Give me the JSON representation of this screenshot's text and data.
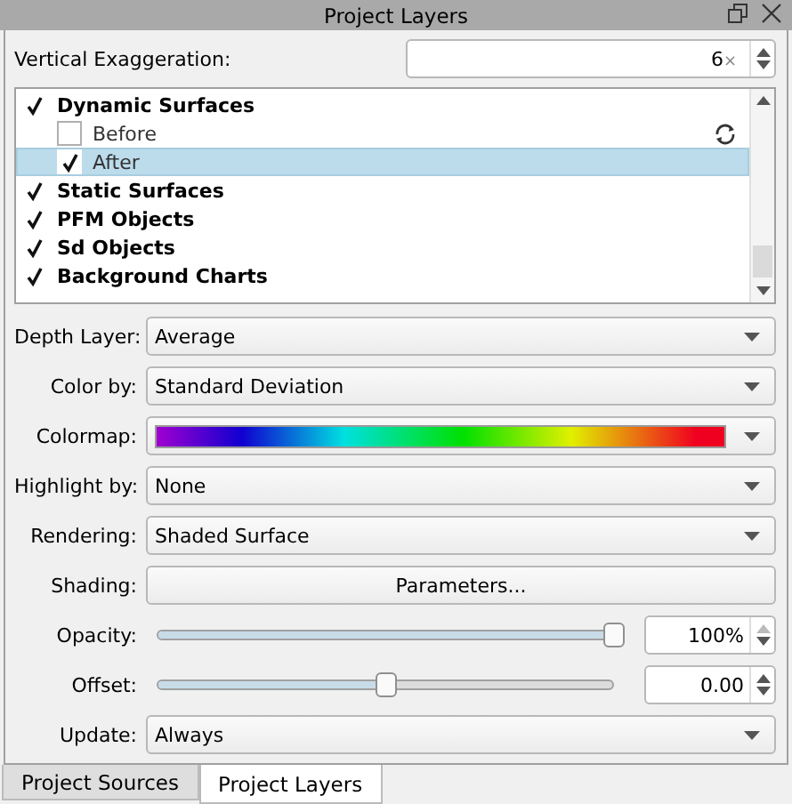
{
  "window": {
    "title": "Project Layers"
  },
  "exaggeration": {
    "label": "Vertical Exaggeration:",
    "value": "6",
    "unit": "×"
  },
  "layers": [
    {
      "label": "Dynamic Surfaces",
      "checked": true,
      "selected": false,
      "children": [
        {
          "label": "Before",
          "checked": false,
          "selected": false,
          "refresh": true
        },
        {
          "label": "After",
          "checked": true,
          "selected": true,
          "refresh": false
        }
      ]
    },
    {
      "label": "Static Surfaces",
      "checked": true,
      "selected": false
    },
    {
      "label": "PFM Objects",
      "checked": true,
      "selected": false
    },
    {
      "label": "Sd Objects",
      "checked": true,
      "selected": false
    },
    {
      "label": "Background Charts",
      "checked": true,
      "selected": false
    }
  ],
  "properties": [
    {
      "kind": "dropdown",
      "label": "Depth Layer:",
      "value": "Average"
    },
    {
      "kind": "dropdown",
      "label": "Color by:",
      "value": "Standard Deviation"
    },
    {
      "kind": "colormap",
      "label": "Colormap:"
    },
    {
      "kind": "dropdown",
      "label": "Highlight by:",
      "value": "None"
    },
    {
      "kind": "dropdown",
      "label": "Rendering:",
      "value": "Shaded Surface"
    },
    {
      "kind": "button",
      "label": "Shading:",
      "value": "Parameters..."
    },
    {
      "kind": "slider",
      "label": "Opacity:",
      "level": 1,
      "value": "100%",
      "disabled_up": true
    },
    {
      "kind": "slider",
      "label": "Offset:",
      "level": 0.5,
      "value": "0.00",
      "disabled_up": false
    },
    {
      "kind": "dropdown",
      "label": "Update:",
      "value": "Always"
    }
  ],
  "tabs": [
    {
      "label": "Project Sources",
      "selected": false
    },
    {
      "label": "Project Layers",
      "selected": true
    }
  ]
}
